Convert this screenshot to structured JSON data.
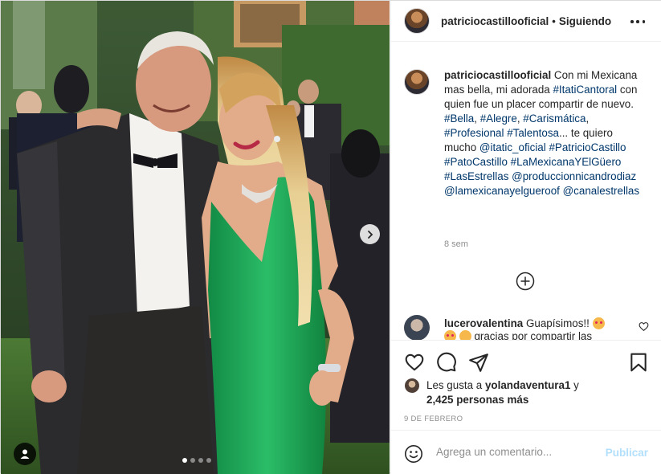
{
  "post": {
    "username": "patriciocastillooficial",
    "follow_status": "Siguiendo",
    "separator": "•",
    "caption": {
      "username": "patriciocastillooficial",
      "text_1": " Con mi Mexicana mas bella, mi adorada ",
      "tag_itati": "#ItatiCantoral",
      "text_2": " con quien fue un placer compartir de nuevo. ",
      "tag_bella": "#Bella",
      "comma_1": ", ",
      "tag_alegre": "#Alegre",
      "comma_2": ", ",
      "tag_carismatica": "#Carismática",
      "comma_3": ", ",
      "tag_profesional": "#Profesional",
      "space_1": " ",
      "tag_talentosa": "#Talentosa",
      "text_3": "... te quiero mucho ",
      "mention_itatic": "@itatic_oficial",
      "space_2": " ",
      "tag_patricio": "#PatricioCastillo",
      "space_3": " ",
      "tag_pato": "#PatoCastillo",
      "space_4": " ",
      "tag_mexicana": "#LaMexicanaYElGüero",
      "space_5": " ",
      "tag_estrellas": "#LasEstrellas",
      "space_6": " ",
      "mention_produccion": "@produccionnicandrodiaz",
      "space_7": " ",
      "mention_lamexicana": "@lamexicanayelgueroof",
      "space_8": " ",
      "mention_canal": "@canalestrellas"
    },
    "time_ago": "8 sem",
    "comment": {
      "username": "lucerovalentina",
      "text": " Guapísimos!! ",
      "more_text": " gracias por compartir las"
    },
    "likes": {
      "prefix": "Les gusta a ",
      "user": "yolandaventura1",
      "suffix": " y",
      "count_text": "2,425 personas más"
    },
    "date": "9 DE FEBRERO",
    "add_comment_placeholder": "Agrega un comentario...",
    "publish_label": "Publicar"
  },
  "carousel": {
    "total": 4,
    "active_index": 0
  },
  "icons": {
    "more": "more-options-icon",
    "next": "chevron-right-icon",
    "tags": "user-tag-icon",
    "like": "heart-icon",
    "comment": "comment-icon",
    "share": "send-icon",
    "save": "bookmark-icon",
    "load_more": "plus-circle-icon",
    "emoji": "smile-icon"
  },
  "colors": {
    "link": "#00376b",
    "secondary_text": "#8e8e8e",
    "publish_disabled": "#b2dffc",
    "dress_green": "#1fa55a"
  }
}
